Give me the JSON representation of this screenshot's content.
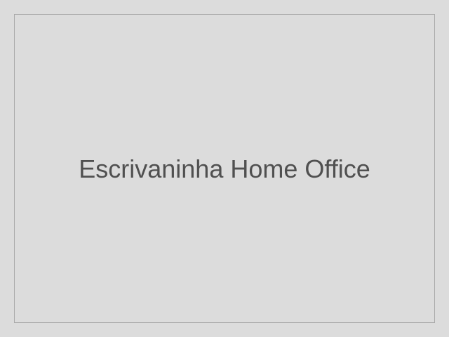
{
  "placeholder": {
    "text": "Escrivaninha Home Office"
  },
  "colors": {
    "background": "#dcdcdc",
    "border": "#aaaaaa",
    "text": "#505050"
  }
}
